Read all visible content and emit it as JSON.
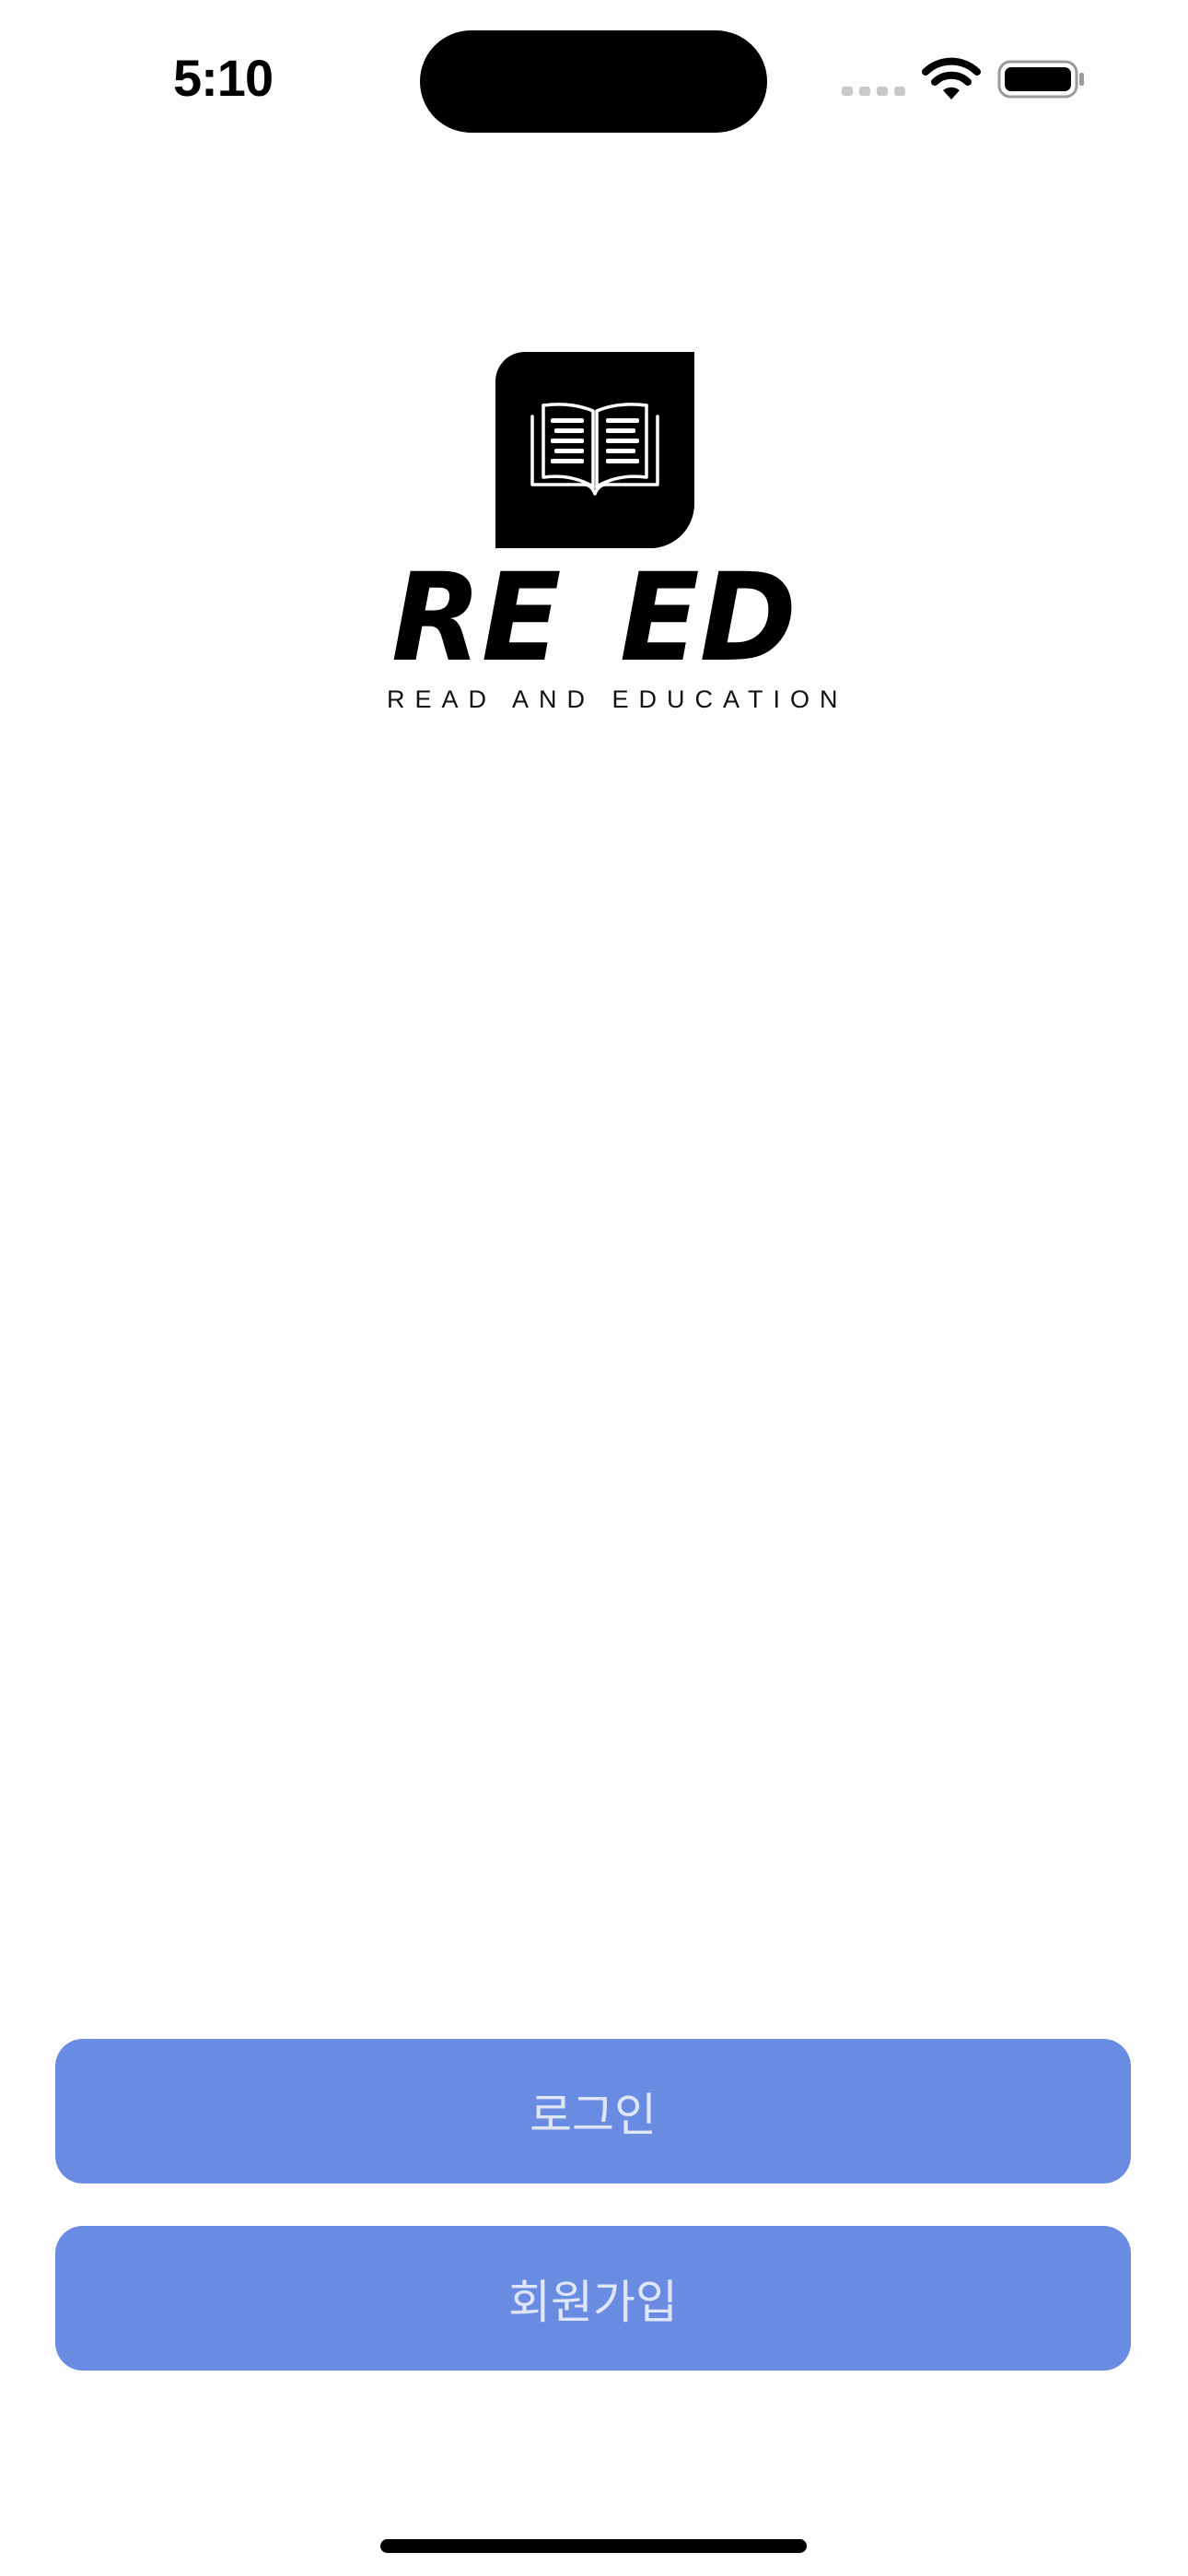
{
  "status_bar": {
    "time": "5:10",
    "icons": [
      "cellular-signal-icon",
      "wifi-icon",
      "battery-icon"
    ]
  },
  "logo": {
    "icon": "open-book-icon",
    "wordmark": "RE_ED",
    "tagline": "READ AND EDUCATION"
  },
  "actions": {
    "login_label": "로그인",
    "signup_label": "회원가입"
  },
  "colors": {
    "button_background": "#6a8be2",
    "button_text": "#dfe6f8",
    "page_background": "#fdfdfd"
  }
}
